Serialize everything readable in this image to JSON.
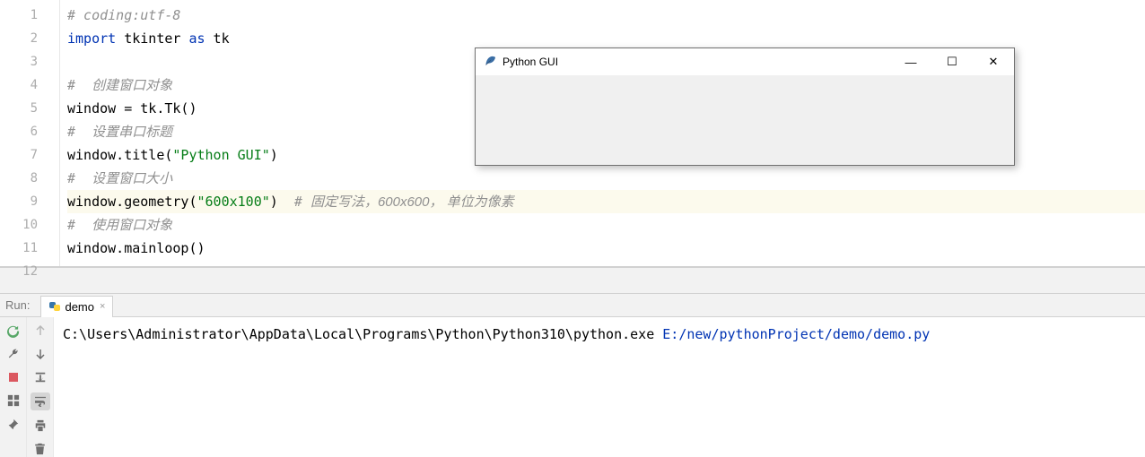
{
  "gutter": [
    "1",
    "2",
    "3",
    "4",
    "5",
    "6",
    "7",
    "8",
    "9",
    "10",
    "11",
    "12"
  ],
  "code": {
    "l1_comment": "# coding:utf-8",
    "l2_import": "import",
    "l2_mod": " tkinter ",
    "l2_as": "as",
    "l2_alias": " tk",
    "l4_comment_hash": "#  ",
    "l4_comment_cn": "创建窗口对象",
    "l5_lhs": "window = tk.Tk()",
    "l6_comment_hash": "#  ",
    "l6_comment_cn": "设置串口标题",
    "l7_call": "window.title(",
    "l7_str": "\"Python GUI\"",
    "l7_close": ")",
    "l8_comment_hash": "#  ",
    "l8_comment_cn": "设置窗口大小",
    "l9_call": "window.geometry(",
    "l9_str": "\"600x100\"",
    "l9_close": ")",
    "l9_caret": "  ",
    "l9_inline_hash": "# ",
    "l9_inline_cn": "固定写法，600x600， 单位为像素",
    "l10_comment_hash": "#  ",
    "l10_comment_cn": "使用窗口对象",
    "l11_call": "window.mainloop()"
  },
  "run": {
    "label": "Run:",
    "tab_name": "demo",
    "tab_close": "×",
    "output_path": "C:\\Users\\Administrator\\AppData\\Local\\Programs\\Python\\Python310\\python.exe ",
    "output_arg": "E:/new/pythonProject/demo/demo.py"
  },
  "tkwin": {
    "title": "Python GUI",
    "minimize": "—",
    "maximize": "☐",
    "close": "✕"
  }
}
